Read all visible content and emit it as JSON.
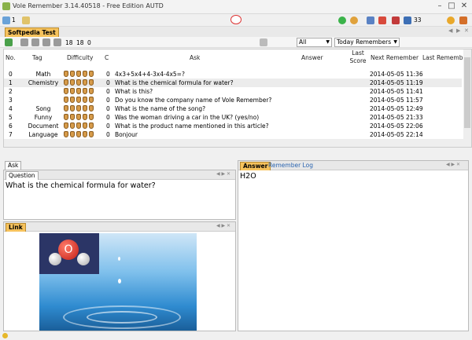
{
  "app": {
    "title": "Vole Remember  3.14.40518 - Free Edition AUTD",
    "badge_count": "33"
  },
  "toolbar": {
    "version_menu_label": "1",
    "counts": [
      "18",
      "18",
      "0"
    ]
  },
  "tabs": [
    {
      "label": "Softpedia Test"
    }
  ],
  "filters": {
    "all_label": "All",
    "today_label": "Today Remembers"
  },
  "grid": {
    "columns": [
      "No.",
      "Tag",
      "Difficulty",
      "C",
      "Ask",
      "Answer",
      "Last Score",
      "Next Remember",
      "Last Remember"
    ],
    "rows": [
      {
        "no": "0",
        "tag": "Math",
        "c": "0",
        "ask": "4x3+5x4+4-3x4-4x5=?",
        "answer": "",
        "score": "",
        "next": "2014-05-05 11:36"
      },
      {
        "no": "1",
        "tag": "Chemistry",
        "c": "0",
        "ask": "What is the chemical formula for water?",
        "answer": "",
        "score": "",
        "next": "2014-05-05 11:19"
      },
      {
        "no": "2",
        "tag": "",
        "c": "0",
        "ask": "What is this?",
        "answer": "",
        "score": "",
        "next": "2014-05-05 11:41"
      },
      {
        "no": "3",
        "tag": "",
        "c": "0",
        "ask": "Do you know the company name of Vole Remember?",
        "answer": "",
        "score": "",
        "next": "2014-05-05 11:57"
      },
      {
        "no": "4",
        "tag": "Song",
        "c": "0",
        "ask": "What is the name of the song?",
        "answer": "",
        "score": "",
        "next": "2014-05-05 12:49"
      },
      {
        "no": "5",
        "tag": "Funny",
        "c": "0",
        "ask": "Was the woman driving a car in the UK?  (yes/no)",
        "answer": "",
        "score": "",
        "next": "2014-05-05 21:33"
      },
      {
        "no": "6",
        "tag": "Document",
        "c": "0",
        "ask": "What is the product name mentioned in this article?",
        "answer": "",
        "score": "",
        "next": "2014-05-05 22:06"
      },
      {
        "no": "7",
        "tag": "Language",
        "c": "0",
        "ask": "Bonjour",
        "answer": "",
        "score": "",
        "next": "2014-05-05 22:14"
      }
    ]
  },
  "ask_panel": {
    "tab_label": "Ask",
    "question_tab": "Question",
    "question_text": "What is the chemical formula for water?"
  },
  "link_panel": {
    "tab_label": "Link",
    "image_label": "O"
  },
  "answer_panel": {
    "tab_label": "Answer",
    "log_tab_label": "Remember Log",
    "answer_text": "H2O"
  }
}
